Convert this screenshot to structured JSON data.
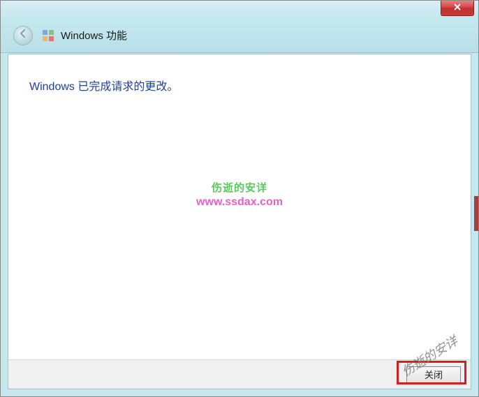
{
  "window": {
    "title": "Windows 功能"
  },
  "content": {
    "message": "Windows 已完成请求的更改。"
  },
  "buttons": {
    "close_label": "关闭"
  },
  "watermark": {
    "text1": "伤逝的安详",
    "url": "www.ssdax.com",
    "diag": "伤逝的安详"
  }
}
